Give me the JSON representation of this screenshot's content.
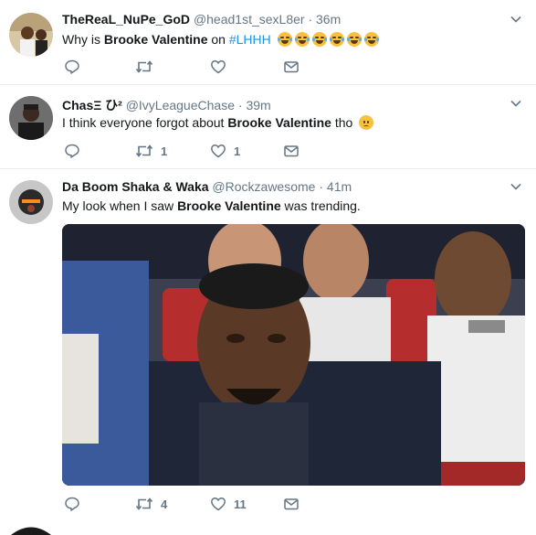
{
  "tweets": [
    {
      "name": "TheReaL_NuPe_GoD",
      "handle": "@head1st_sexL8er",
      "time": "36m",
      "text": {
        "pre": "Why is ",
        "bold": "Brooke Valentine",
        "mid": " on ",
        "hashtag": "#LHHH",
        "post": ""
      },
      "emoji": "face-with-tears-of-joy x6",
      "retweets": "",
      "likes": ""
    },
    {
      "name": "ChasΞ ひ²",
      "handle": "@IvyLeagueChase",
      "time": "39m",
      "text": {
        "pre": "I think everyone forgot about ",
        "bold": "Brooke Valentine",
        "post": " tho"
      },
      "emoji": "worried-face",
      "retweets": "1",
      "likes": "1"
    },
    {
      "name": "Da Boom Shaka & Waka",
      "handle": "@Rockzawesome",
      "time": "41m",
      "text": {
        "pre": "My look when I saw ",
        "bold": "Brooke Valentine",
        "post": " was trending."
      },
      "retweets": "4",
      "likes": "11",
      "media": "photo of a man in a dark t-shirt seated in an audience, staring sideways; people laughing behind him"
    }
  ],
  "separator": "·",
  "colors": {
    "link": "#1b95e0",
    "muted": "#657786",
    "border": "#e6ecf0",
    "text": "#14171a"
  },
  "icons": [
    "reply-icon",
    "retweet-icon",
    "like-icon",
    "dm-icon",
    "caret-down-icon"
  ]
}
